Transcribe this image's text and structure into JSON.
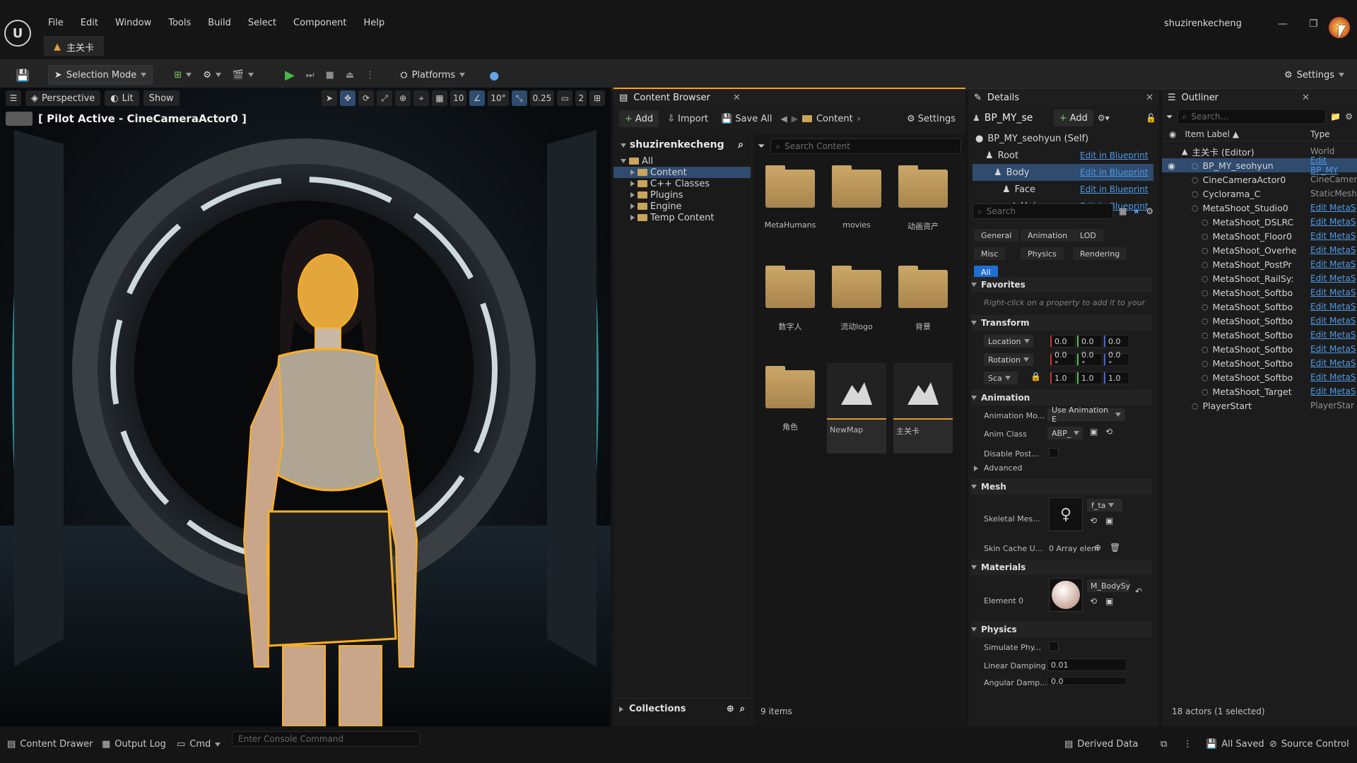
{
  "menu": [
    "File",
    "Edit",
    "Window",
    "Tools",
    "Build",
    "Select",
    "Component",
    "Help"
  ],
  "user": "shuzirenkecheng",
  "level_tab": "主关卡",
  "toolbar": {
    "selection_mode": "Selection Mode",
    "platforms": "Platforms",
    "settings": "Settings"
  },
  "viewport": {
    "perspective": "Perspective",
    "lit": "Lit",
    "show": "Show",
    "grid_size": "10",
    "rot_snap": "10°",
    "scale_snap": "0.25",
    "cam_speed": "2",
    "pilot": "[ Pilot Active - CineCameraActor0 ]"
  },
  "content_browser": {
    "tab": "Content Browser",
    "add": "Add",
    "import": "Import",
    "save_all": "Save All",
    "path": "Content",
    "settings": "Settings",
    "project": "shuzirenkecheng",
    "search_placeholder": "Search Content",
    "tree": [
      {
        "label": "All",
        "depth": 0
      },
      {
        "label": "Content",
        "depth": 1
      },
      {
        "label": "C++ Classes",
        "depth": 1
      },
      {
        "label": "Plugins",
        "depth": 1
      },
      {
        "label": "Engine",
        "depth": 1
      },
      {
        "label": "Temp Content",
        "depth": 1
      }
    ],
    "assets": [
      {
        "label": "MetaHumans",
        "kind": "folder"
      },
      {
        "label": "movies",
        "kind": "folder"
      },
      {
        "label": "动画资产",
        "kind": "folder"
      },
      {
        "label": "数字人",
        "kind": "folder"
      },
      {
        "label": "流动logo",
        "kind": "folder"
      },
      {
        "label": "背景",
        "kind": "folder"
      },
      {
        "label": "角色",
        "kind": "folder"
      },
      {
        "label": "NewMap",
        "kind": "map"
      },
      {
        "label": "主关卡",
        "kind": "map"
      }
    ],
    "collections": "Collections",
    "count": "9 items"
  },
  "details": {
    "tab": "Details",
    "actor": "BP_MY_se",
    "add": "Add",
    "self": "BP_MY_seohyun (Self)",
    "components": [
      {
        "label": "Root",
        "link": "Edit in Blueprint"
      },
      {
        "label": "Body",
        "link": "Edit in Blueprint"
      },
      {
        "label": "Face",
        "link": "Edit in Blueprint"
      },
      {
        "label": "Hair",
        "link": "Edit in Blueprint"
      }
    ],
    "search_placeholder": "Search",
    "categories": [
      "General",
      "Animation",
      "LOD",
      "Misc",
      "Physics",
      "Rendering",
      "All"
    ],
    "favorites": "Favorites",
    "favorites_hint": "Right-click on a property to add it to your",
    "transform": "Transform",
    "location": "Location",
    "rotation": "Rotation",
    "scale": "Sca",
    "loc_vals": [
      "0.0",
      "0.0",
      "0.0"
    ],
    "rot_vals": [
      "0.0 °",
      "0.0 °",
      "0.0 °"
    ],
    "scale_vals": [
      "1.0",
      "1.0",
      "1.0"
    ],
    "animation": "Animation",
    "anim_mode_label": "Animation Mo...",
    "anim_mode_val": "Use Animation E",
    "anim_class_label": "Anim Class",
    "anim_class_val": "ABP_",
    "disable_post": "Disable Post...",
    "advanced": "Advanced",
    "mesh": "Mesh",
    "skeletal_mesh": "Skeletal Mes...",
    "mesh_val": "f_ta",
    "skin_cache": "Skin Cache U...",
    "skin_cache_val": "0 Array elem",
    "materials": "Materials",
    "element0": "Element 0",
    "mat_val": "M_BodySy",
    "physics": "Physics",
    "simulate": "Simulate Phy...",
    "linear_damping": "Linear Damping",
    "linear_damping_val": "0.01",
    "angular_damping": "Angular Damp...",
    "angular_damping_val": "0.0"
  },
  "outliner": {
    "tab": "Outliner",
    "search_placeholder": "Search...",
    "col_label": "Item Label ▲",
    "col_type": "Type",
    "rows": [
      {
        "label": "主关卡 (Editor)",
        "type": "World",
        "depth": 1,
        "link": false
      },
      {
        "label": "BP_MY_seohyun",
        "type": "Edit BP_MY",
        "depth": 2,
        "link": true
      },
      {
        "label": "CineCameraActor0",
        "type": "CineCamer",
        "depth": 2,
        "link": false
      },
      {
        "label": "Cyclorama_C",
        "type": "StaticMesh",
        "depth": 2,
        "link": false
      },
      {
        "label": "MetaShoot_Studio0",
        "type": "Edit MetaS",
        "depth": 2,
        "link": true
      },
      {
        "label": "MetaShoot_DSLRC",
        "type": "Edit MetaS",
        "depth": 3,
        "link": true
      },
      {
        "label": "MetaShoot_Floor0",
        "type": "Edit MetaS",
        "depth": 3,
        "link": true
      },
      {
        "label": "MetaShoot_Overhe",
        "type": "Edit MetaS",
        "depth": 3,
        "link": true
      },
      {
        "label": "MetaShoot_PostPr",
        "type": "Edit MetaS",
        "depth": 3,
        "link": true
      },
      {
        "label": "MetaShoot_RailSy:",
        "type": "Edit MetaS",
        "depth": 3,
        "link": true
      },
      {
        "label": "MetaShoot_Softbo",
        "type": "Edit MetaS",
        "depth": 3,
        "link": true
      },
      {
        "label": "MetaShoot_Softbo",
        "type": "Edit MetaS",
        "depth": 3,
        "link": true
      },
      {
        "label": "MetaShoot_Softbo",
        "type": "Edit MetaS",
        "depth": 3,
        "link": true
      },
      {
        "label": "MetaShoot_Softbo",
        "type": "Edit MetaS",
        "depth": 3,
        "link": true
      },
      {
        "label": "MetaShoot_Softbo",
        "type": "Edit MetaS",
        "depth": 3,
        "link": true
      },
      {
        "label": "MetaShoot_Softbo",
        "type": "Edit MetaS",
        "depth": 3,
        "link": true
      },
      {
        "label": "MetaShoot_Softbo",
        "type": "Edit MetaS",
        "depth": 3,
        "link": true
      },
      {
        "label": "MetaShoot_Target",
        "type": "Edit MetaS",
        "depth": 3,
        "link": true
      },
      {
        "label": "PlayerStart",
        "type": "PlayerStar",
        "depth": 2,
        "link": false
      }
    ],
    "count": "18 actors (1 selected)"
  },
  "status": {
    "content_drawer": "Content Drawer",
    "output_log": "Output Log",
    "cmd": "Cmd",
    "console_placeholder": "Enter Console Command",
    "derived_data": "Derived Data",
    "all_saved": "All Saved",
    "source_control": "Source Control"
  },
  "colors": {
    "accent": "#ff9f1a",
    "selection": "#2f4b6e",
    "link": "#4c9ae8",
    "folder": "#c8a466"
  }
}
